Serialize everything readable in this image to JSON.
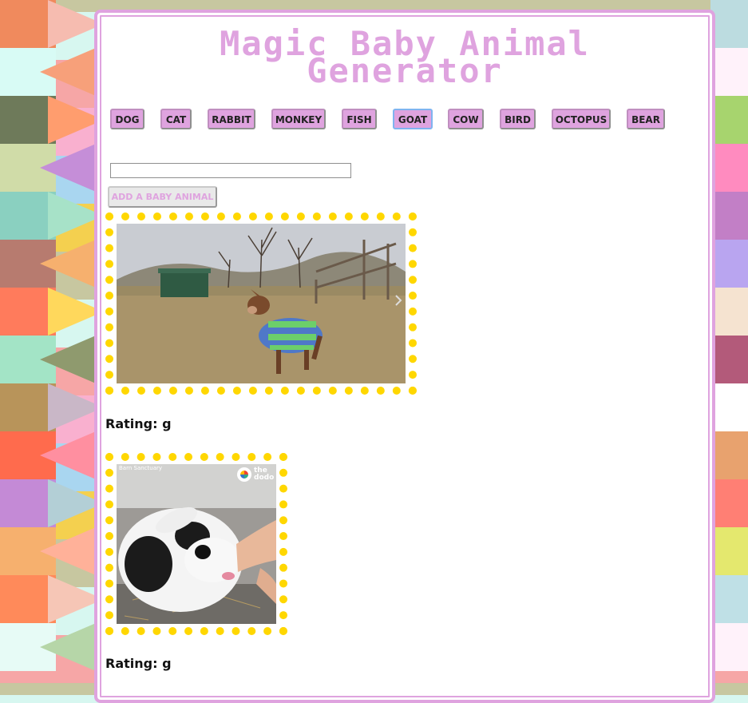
{
  "header": {
    "title_line1": "Magic Baby Animal",
    "title_line2": "Generator"
  },
  "animal_buttons": [
    {
      "label": "DOG"
    },
    {
      "label": "CAT"
    },
    {
      "label": "RABBIT"
    },
    {
      "label": "MONKEY"
    },
    {
      "label": "FISH"
    },
    {
      "label": "GOAT",
      "active": true
    },
    {
      "label": "COW"
    },
    {
      "label": "BIRD"
    },
    {
      "label": "OCTOPUS"
    },
    {
      "label": "BEAR"
    }
  ],
  "search": {
    "value": "",
    "add_label": "ADD A BABY ANIMAL"
  },
  "results": [
    {
      "rating": "Rating: g",
      "alt": "baby goat in striped sweater"
    },
    {
      "rating": "Rating: g",
      "alt": "black and white baby goat",
      "watermark": "Barn Sanctuary",
      "brand": "the dodo"
    }
  ],
  "colors": {
    "accent": "#dfa3df",
    "frame": "#ffd700"
  }
}
